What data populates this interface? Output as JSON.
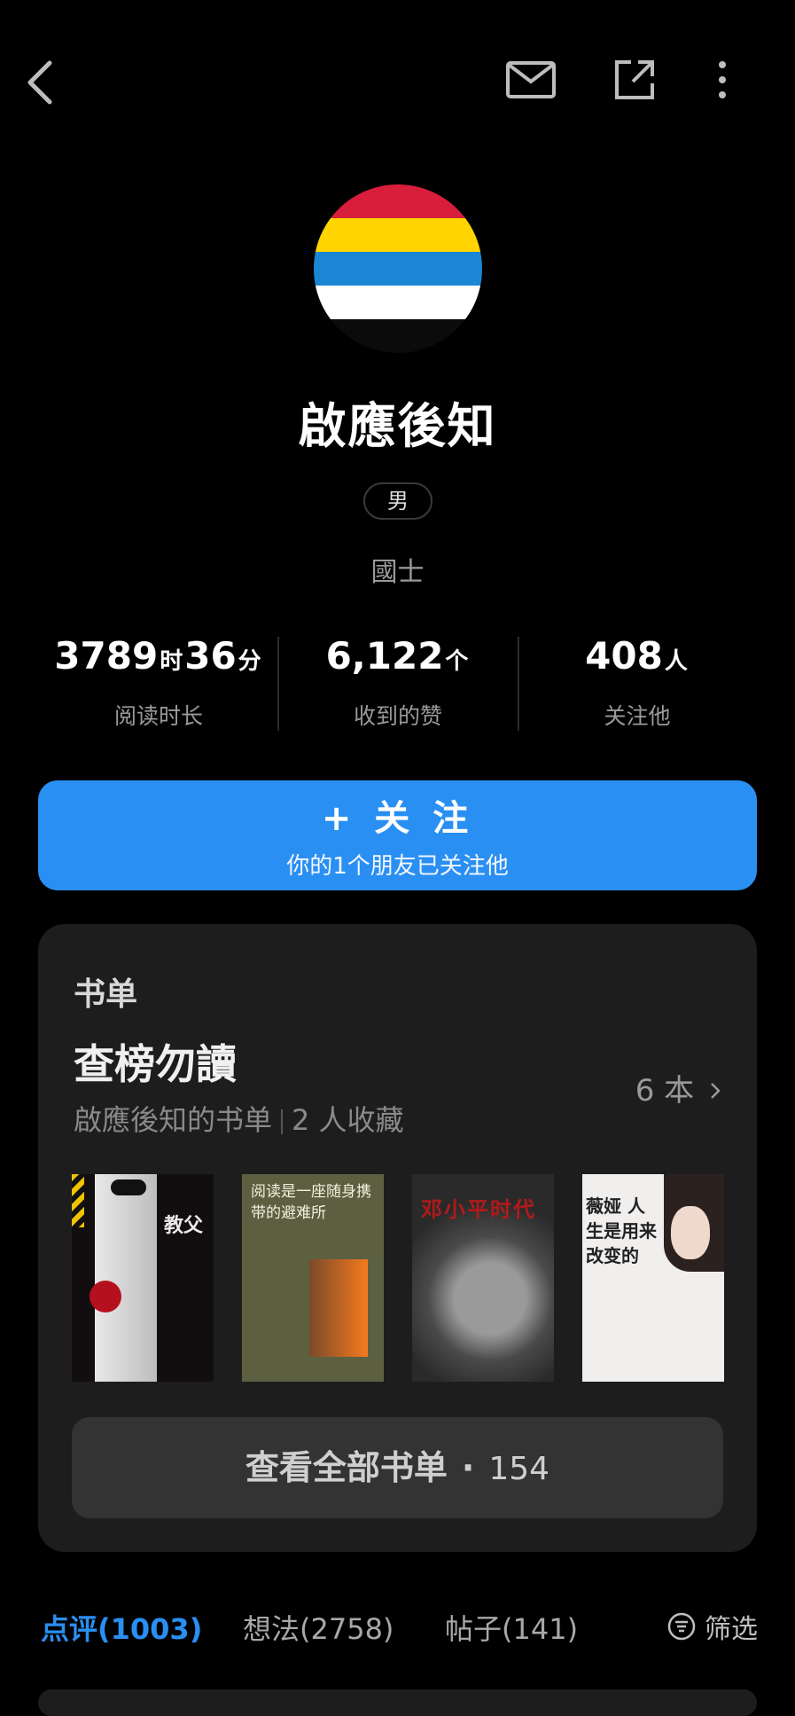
{
  "profile": {
    "name": "啟應後知",
    "gender": "男",
    "title": "國士",
    "avatar_colors": [
      "#d81e3a",
      "#ffd400",
      "#1a86d4",
      "#ffffff",
      "#0b0b0b"
    ]
  },
  "stats": [
    {
      "parts": [
        {
          "v": "3789",
          "u": "时"
        },
        {
          "v": "36",
          "u": "分"
        }
      ],
      "label": "阅读时长"
    },
    {
      "parts": [
        {
          "v": "6,122",
          "u": "个"
        }
      ],
      "label": "收到的赞"
    },
    {
      "parts": [
        {
          "v": "408",
          "u": "人"
        }
      ],
      "label": "关注他"
    }
  ],
  "follow": {
    "label": "+ 关 注",
    "sub": "你的1个朋友已关注他"
  },
  "booklist": {
    "section_label": "书单",
    "title": "查榜勿讀",
    "owner_text": "啟應後知的书单",
    "saved_text": "2 人收藏",
    "count_label": "6 本",
    "books": [
      {
        "title": "教父"
      },
      {
        "title": "阅读是一座随身携带的避难所"
      },
      {
        "title": "邓小平时代"
      },
      {
        "title": "薇娅 人生是用来改变的"
      }
    ],
    "view_all_label": "查看全部书单",
    "view_all_count": "154"
  },
  "tabs": [
    {
      "label": "点评(1003)",
      "active": true
    },
    {
      "label": "想法(2758)",
      "active": false
    },
    {
      "label": "帖子(141)",
      "active": false
    }
  ],
  "filter_label": "筛选",
  "accent": "#2a8ff2"
}
